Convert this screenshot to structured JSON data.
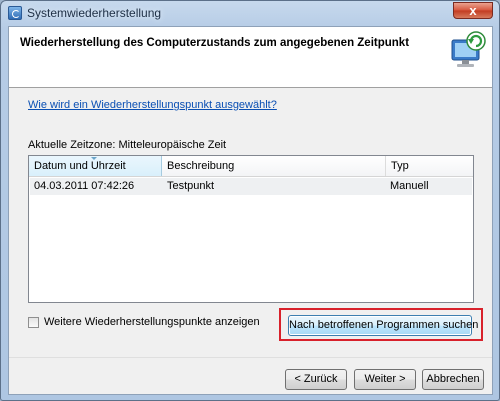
{
  "window": {
    "title": "Systemwiederherstellung",
    "close_label": "x"
  },
  "header": {
    "title": "Wiederherstellung des Computerzustands zum angegebenen Zeitpunkt",
    "icon": "system-restore-icon"
  },
  "help_link": "Wie wird ein Wiederherstellungspunkt ausgewählt?",
  "timezone_label": "Aktuelle Zeitzone: Mitteleuropäische Zeit",
  "table": {
    "columns": [
      "Datum und Uhrzeit",
      "Beschreibung",
      "Typ"
    ],
    "rows": [
      {
        "date": "04.03.2011 07:42:26",
        "description": "Testpunkt",
        "type": "Manuell"
      }
    ]
  },
  "more_points_label": "Weitere Wiederherstellungspunkte anzeigen",
  "scan_button": "Nach betroffenen Programmen suchen",
  "buttons": {
    "back": "< Zurück",
    "next": "Weiter >",
    "cancel": "Abbrechen"
  },
  "colors": {
    "highlight": "#d8212b",
    "link": "#0a4fb3"
  }
}
